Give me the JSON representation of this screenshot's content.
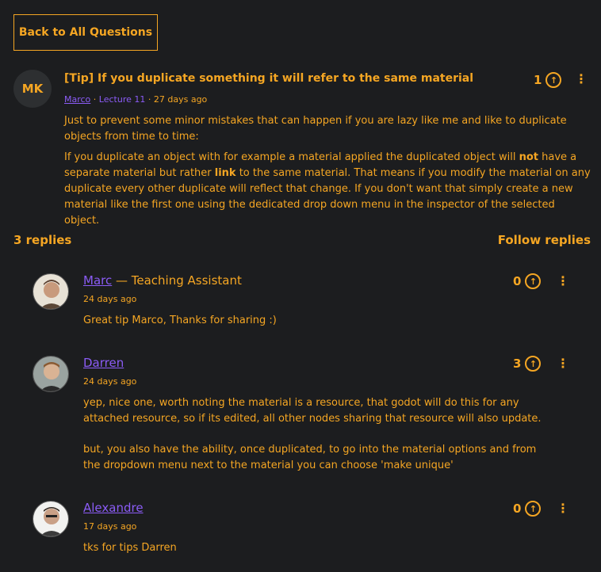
{
  "back_button": "Back to All Questions",
  "question": {
    "avatar_initials": "MK",
    "title": "[Tip] If you duplicate something it will refer to the same material",
    "author": "Marco",
    "lecture": "Lecture 11",
    "age": "27 days ago",
    "votes": "1",
    "body_p1": "Just to prevent some minor mistakes that can happen if you are lazy like me and like to duplicate objects from time to time:",
    "body_p2_a": "If you duplicate an object with for example a material applied the duplicated object will ",
    "body_p2_b": "not",
    "body_p2_c": " have a separate material but rather ",
    "body_p2_d": "link",
    "body_p2_e": " to the same material. That means if you modify the material on any duplicate every other duplicate will reflect that change. If you don't want that simply create a new material like the first one using the dedicated drop down menu in the inspector of the selected object."
  },
  "replies_header": {
    "count_label": "3 replies",
    "follow_label": "Follow replies"
  },
  "replies": [
    {
      "name": "Marc",
      "role": " — Teaching Assistant",
      "date": "24 days ago",
      "votes": "0",
      "body_p1": "Great tip Marco, Thanks for sharing :)"
    },
    {
      "name": "Darren",
      "role": "",
      "date": "24 days ago",
      "votes": "3",
      "body_p1": "yep, nice one, worth noting the material is a resource, that godot will do this for any attached resource, so if its edited, all other nodes sharing that resource will also update.",
      "body_p2": "but, you also have the ability, once duplicated, to go into the material options and from the dropdown menu next to the material you can choose 'make unique'"
    },
    {
      "name": "Alexandre",
      "role": "",
      "date": "17 days ago",
      "votes": "0",
      "body_p1": "tks for tips Darren"
    }
  ],
  "colors": {
    "background": "#1c1d1f",
    "text": "#f5a623",
    "link": "#8b5cf6"
  },
  "icons": {
    "upvote": "arrow-up-circle",
    "more": "kebab-vertical"
  }
}
